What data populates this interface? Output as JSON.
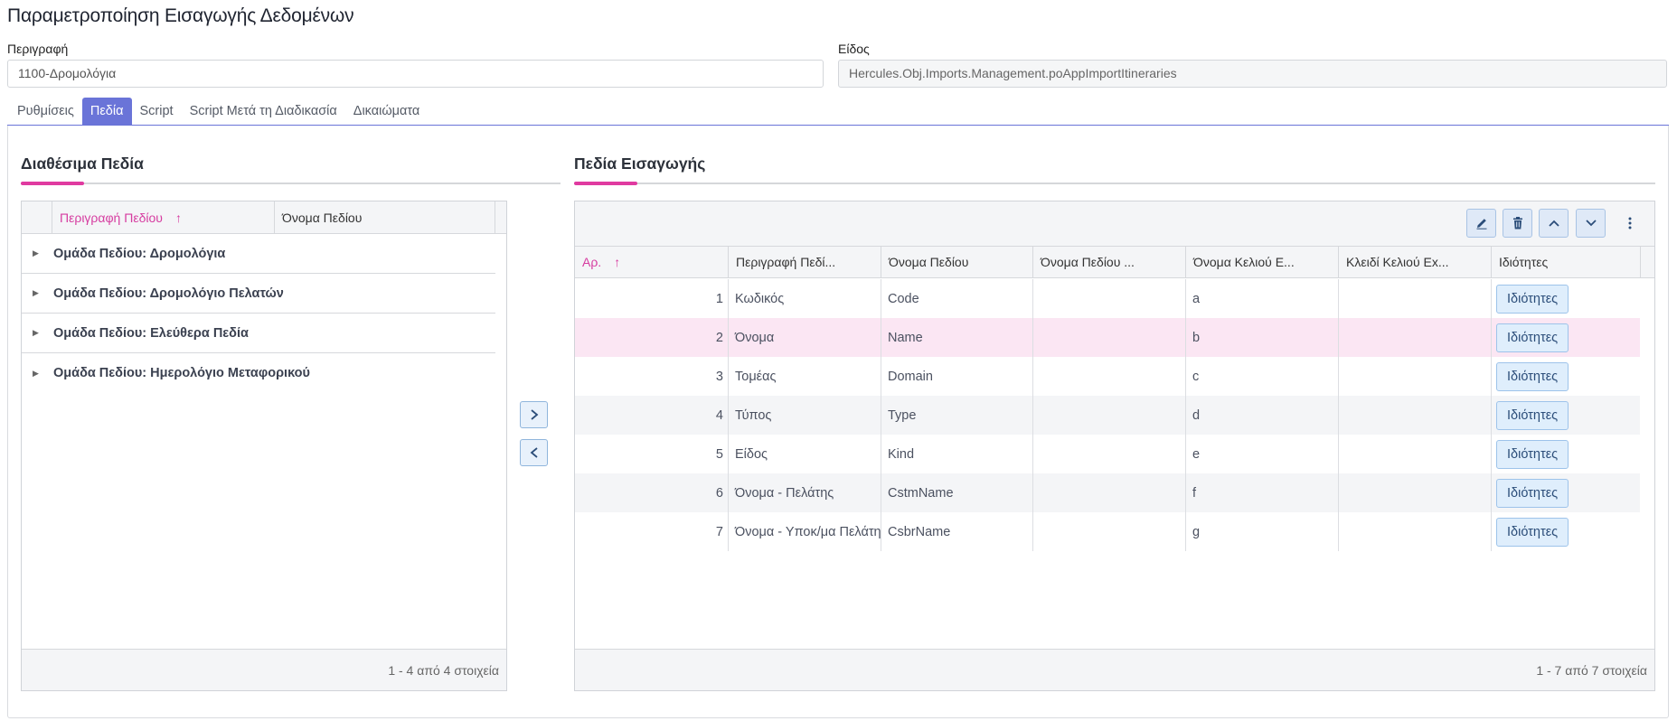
{
  "title": "Παραμετροποίηση Εισαγωγής Δεδομένων",
  "description": {
    "label": "Περιγραφή",
    "value": "1100-Δρομολόγια"
  },
  "kind": {
    "label": "Είδος",
    "value": "Hercules.Obj.Imports.Management.poAppImportItineraries"
  },
  "tabs": [
    {
      "label": "Ρυθμίσεις"
    },
    {
      "label": "Πεδία",
      "active": true
    },
    {
      "label": "Script"
    },
    {
      "label": "Script Μετά τη Διαδικασία"
    },
    {
      "label": "Δικαιώματα"
    }
  ],
  "available": {
    "title": "Διαθέσιμα Πεδία",
    "headers": [
      "Περιγραφή Πεδίου",
      "Όνομα Πεδίου"
    ],
    "groups": [
      "Ομάδα Πεδίου: Δρομολόγια",
      "Ομάδα Πεδίου: Δρομολόγιο Πελατών",
      "Ομάδα Πεδίου: Ελεύθερα Πεδία",
      "Ομάδα Πεδίου: Ημερολόγιο Μεταφορικού"
    ],
    "footer": "1 - 4 από 4 στοιχεία"
  },
  "import": {
    "title": "Πεδία Εισαγωγής",
    "headers": [
      "Αρ.",
      "Περιγραφή Πεδί...",
      "Όνομα Πεδίου",
      "Όνομα Πεδίου ...",
      "Όνομα Κελιού Ε...",
      "Κλειδί Κελιού Ex...",
      "Ιδιότητες"
    ],
    "button_label": "Ιδιότητες",
    "rows": [
      {
        "n": "1",
        "desc": "Κωδικός",
        "name": "Code",
        "col": "",
        "cell": "a",
        "key": ""
      },
      {
        "n": "2",
        "desc": "Όνομα",
        "name": "Name",
        "col": "",
        "cell": "b",
        "key": ""
      },
      {
        "n": "3",
        "desc": "Τομέας",
        "name": "Domain",
        "col": "",
        "cell": "c",
        "key": ""
      },
      {
        "n": "4",
        "desc": "Τύπος",
        "name": "Type",
        "col": "",
        "cell": "d",
        "key": ""
      },
      {
        "n": "5",
        "desc": "Είδος",
        "name": "Kind",
        "col": "",
        "cell": "e",
        "key": ""
      },
      {
        "n": "6",
        "desc": "Όνομα - Πελάτης",
        "name": "CstmName",
        "col": "",
        "cell": "f",
        "key": ""
      },
      {
        "n": "7",
        "desc": "Όνομα - Υποκ/μα Πελάτη",
        "name": "CsbrName",
        "col": "",
        "cell": "g",
        "key": ""
      }
    ],
    "footer": "1 - 7 από 7 στοιχεία"
  },
  "colors": {
    "accent": "#6a74d8",
    "sort": "#d63ca0",
    "selected_row": "#fbe6f3"
  }
}
